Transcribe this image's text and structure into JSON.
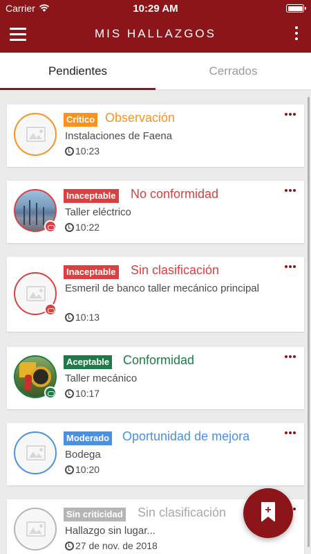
{
  "status_bar": {
    "carrier": "Carrier",
    "time": "10:29 AM"
  },
  "app_bar": {
    "title": "MIS HALLAZGOS",
    "menu_icon": "hamburger-icon",
    "more_icon": "more-vertical-icon"
  },
  "tabs": [
    {
      "label": "Pendientes",
      "active": true
    },
    {
      "label": "Cerrados",
      "active": false
    }
  ],
  "colors": {
    "brand": "#8b1518",
    "critico": "#f7931e",
    "inaceptable": "#d94040",
    "aceptable": "#1e7b47",
    "moderado": "#4a90e2",
    "sin_criticidad": "#b5b5b5"
  },
  "findings": [
    {
      "criticality": "Crítico",
      "type": "Observación",
      "place": "Instalaciones de Faena",
      "time": "10:23",
      "image": "placeholder",
      "has_attachment": false
    },
    {
      "criticality": "Inaceptable",
      "type": "No conformidad",
      "place": "Taller eléctrico",
      "time": "10:22",
      "image": "photo",
      "has_attachment": true
    },
    {
      "criticality": "Inaceptable",
      "type": "Sin clasificación",
      "place": "Esmeril de banco taller mecánico principal",
      "time": "10:13",
      "image": "placeholder",
      "has_attachment": true
    },
    {
      "criticality": "Aceptable",
      "type": "Conformidad",
      "place": "Taller mecánico",
      "time": "10:17",
      "image": "photo",
      "has_attachment": true
    },
    {
      "criticality": "Moderado",
      "type": "Oportunidad de mejora",
      "place": "Bodega",
      "time": "10:20",
      "image": "placeholder",
      "has_attachment": false
    },
    {
      "criticality": "Sin criticidad",
      "type": "Sin clasificación",
      "place": "Hallazgo sin lugar...",
      "time": "27 de nov. de 2018",
      "image": "placeholder",
      "has_attachment": false
    }
  ],
  "fab": {
    "icon": "add-bookmark-icon",
    "plus": "+"
  }
}
